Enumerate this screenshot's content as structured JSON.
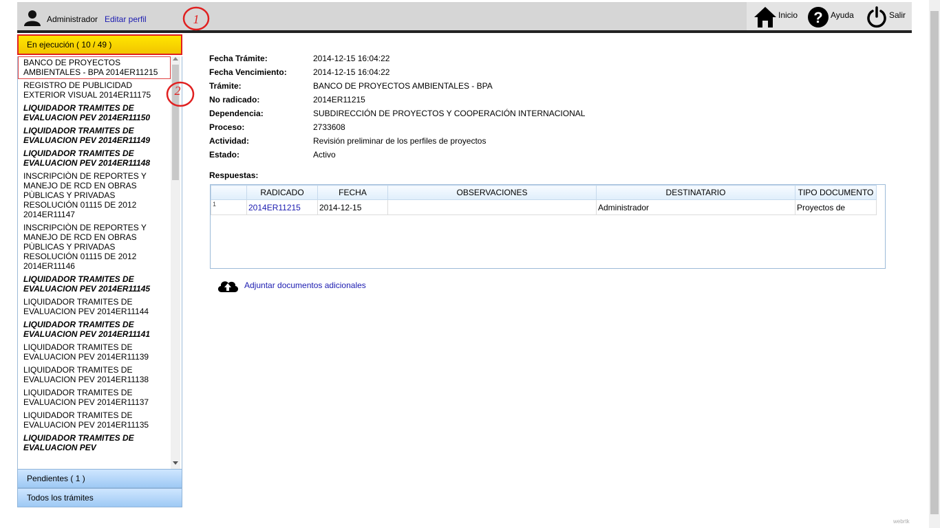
{
  "header": {
    "user_name": "Administrador",
    "edit_profile": "Editar perfil",
    "annotation_1": "1",
    "nav": {
      "home": "Inicio",
      "help": "Ayuda",
      "logout": "Salir"
    }
  },
  "sidebar": {
    "running_label": "En ejecución ( 10 / 49 )",
    "pending_label": "Pendientes ( 1 )",
    "all_label": "Todos los trámites",
    "annotation_2": "2",
    "tasks": [
      {
        "text": "BANCO DE PROYECTOS AMBIENTALES - BPA 2014ER11215",
        "bold": false,
        "selected": true
      },
      {
        "text": "REGISTRO DE PUBLICIDAD EXTERIOR VISUAL 2014ER11175",
        "bold": false
      },
      {
        "text": "LIQUIDADOR TRAMITES DE EVALUACION PEV 2014ER11150",
        "bold": true
      },
      {
        "text": "LIQUIDADOR TRAMITES DE EVALUACION PEV 2014ER11149",
        "bold": true
      },
      {
        "text": "LIQUIDADOR TRAMITES DE EVALUACION PEV 2014ER11148",
        "bold": true
      },
      {
        "text": "INSCRIPCIÒN DE REPORTES Y MANEJO DE RCD EN OBRAS PÙBLICAS Y PRIVADAS RESOLUCIÓN 01115 DE 2012 2014ER11147",
        "bold": false
      },
      {
        "text": "INSCRIPCIÒN DE REPORTES Y MANEJO DE RCD EN OBRAS PÙBLICAS Y PRIVADAS RESOLUCIÓN 01115 DE 2012 2014ER11146",
        "bold": false
      },
      {
        "text": "LIQUIDADOR TRAMITES DE EVALUACION PEV 2014ER11145",
        "bold": true
      },
      {
        "text": "LIQUIDADOR TRAMITES DE EVALUACION PEV 2014ER11144",
        "bold": false
      },
      {
        "text": "LIQUIDADOR TRAMITES DE EVALUACION PEV 2014ER11141",
        "bold": true
      },
      {
        "text": "LIQUIDADOR TRAMITES DE EVALUACION PEV 2014ER11139",
        "bold": false
      },
      {
        "text": "LIQUIDADOR TRAMITES DE EVALUACION PEV 2014ER11138",
        "bold": false
      },
      {
        "text": "LIQUIDADOR TRAMITES DE EVALUACION PEV 2014ER11137",
        "bold": false
      },
      {
        "text": "LIQUIDADOR TRAMITES DE EVALUACION PEV 2014ER11135",
        "bold": false
      },
      {
        "text": "LIQUIDADOR TRAMITES DE EVALUACION PEV",
        "bold": true
      }
    ]
  },
  "details": [
    {
      "label": "Fecha Trámite:",
      "value": "2014-12-15 16:04:22"
    },
    {
      "label": "Fecha Vencimiento:",
      "value": "2014-12-15 16:04:22"
    },
    {
      "label": "Trámite:",
      "value": "BANCO DE PROYECTOS AMBIENTALES - BPA"
    },
    {
      "label": "No radicado:",
      "value": "2014ER11215"
    },
    {
      "label": "Dependencia:",
      "value": "SUBDIRECCIÓN DE PROYECTOS Y COOPERACIÓN INTERNACIONAL"
    },
    {
      "label": "Proceso:",
      "value": "2733608"
    },
    {
      "label": "Actividad:",
      "value": "Revisión preliminar de los perfiles de proyectos"
    },
    {
      "label": "Estado:",
      "value": "Activo"
    }
  ],
  "responses": {
    "label": "Respuestas:",
    "columns": [
      "",
      "RADICADO",
      "FECHA",
      "OBSERVACIONES",
      "DESTINATARIO",
      "TIPO DOCUMENTO"
    ],
    "rows": [
      {
        "num": "1",
        "radicado": "2014ER11215",
        "fecha": "2014-12-15",
        "observaciones": "",
        "destinatario": "Administrador",
        "tipo": "Proyectos de"
      }
    ]
  },
  "upload_label": "Adjuntar documentos adicionales",
  "footer": "webrtk"
}
